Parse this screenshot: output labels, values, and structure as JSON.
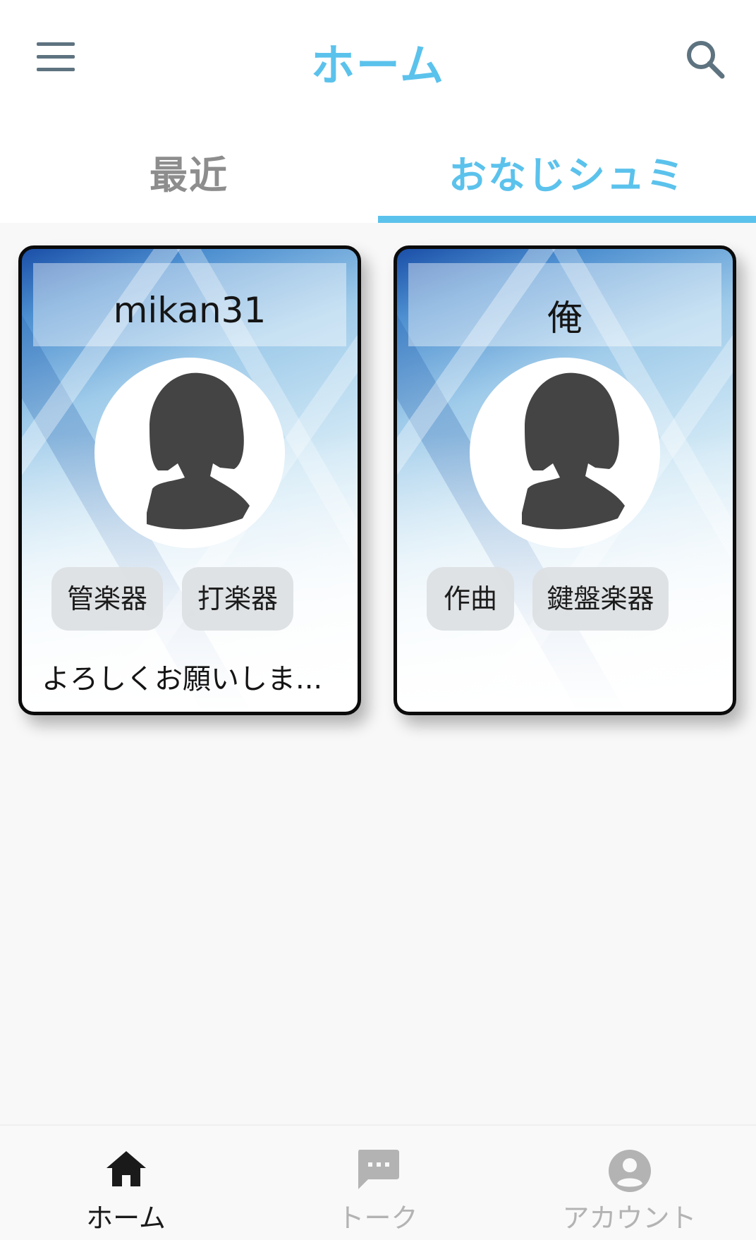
{
  "header": {
    "title": "ホーム"
  },
  "tabs": [
    {
      "label": "最近"
    },
    {
      "label": "おなじシュミ"
    }
  ],
  "cards": [
    {
      "name": "mikan31",
      "tags": [
        "管楽器",
        "打楽器"
      ],
      "bio": "よろしくお願いしま..."
    },
    {
      "name": "俺",
      "tags": [
        "作曲",
        "鍵盤楽器"
      ],
      "bio": ""
    }
  ],
  "bottom_nav": {
    "items": [
      {
        "label": "ホーム",
        "icon": "home-icon"
      },
      {
        "label": "トーク",
        "icon": "chat-icon"
      },
      {
        "label": "アカウント",
        "icon": "account-icon"
      }
    ]
  },
  "colors": {
    "accent": "#5bc2ec",
    "inactive": "#b3b3b3",
    "tab_inactive": "#8d8d8d"
  }
}
